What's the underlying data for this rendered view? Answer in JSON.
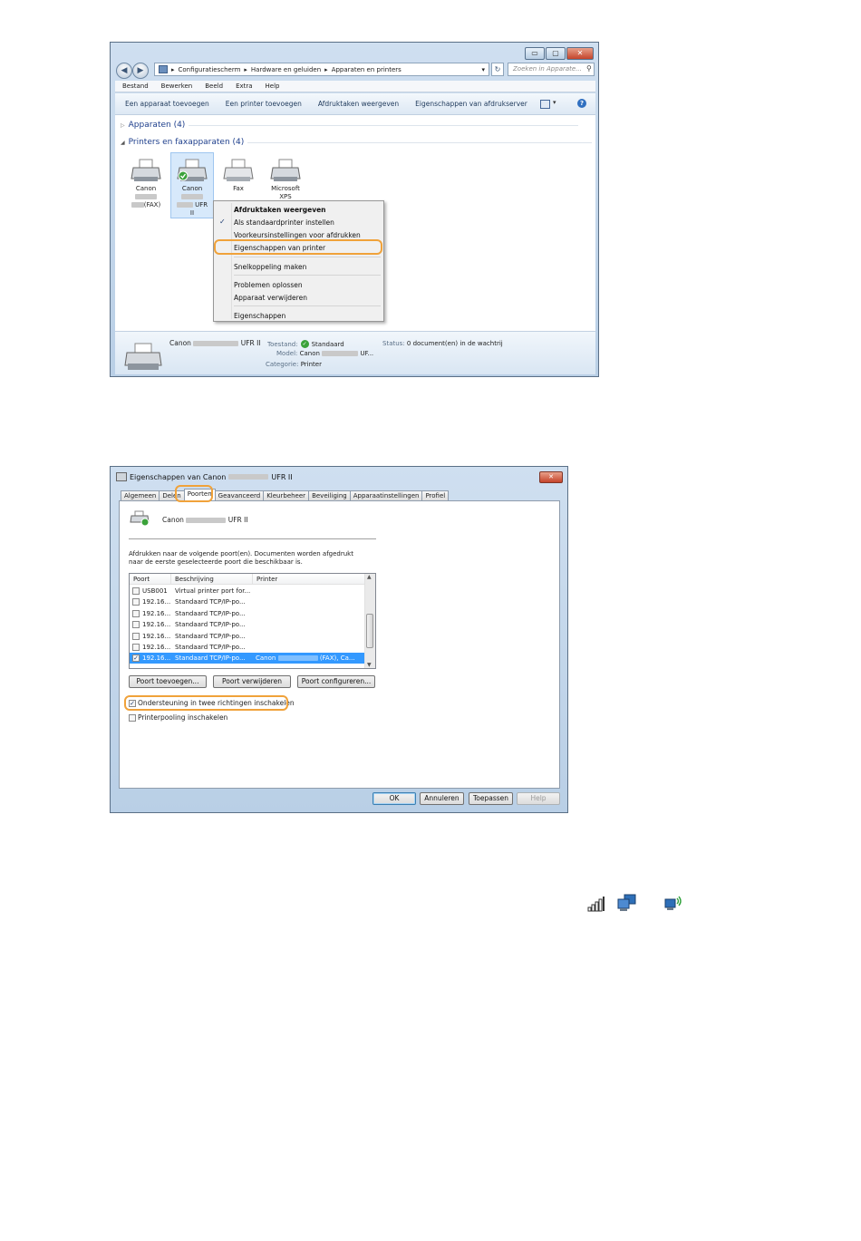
{
  "explorer": {
    "window_controls": {
      "minimize": "▭",
      "maximize": "▢",
      "close": "✕"
    },
    "breadcrumb": [
      "Configuratiescherm",
      "Hardware en geluiden",
      "Apparaten en printers"
    ],
    "search_placeholder": "Zoeken in Apparate...",
    "menu": [
      "Bestand",
      "Bewerken",
      "Beeld",
      "Extra",
      "Help"
    ],
    "commands": [
      "Een apparaat toevoegen",
      "Een printer toevoegen",
      "Afdruktaken weergeven",
      "Eigenschappen van afdrukserver",
      "»"
    ],
    "groups": {
      "devices": "Apparaten (4)",
      "printers": "Printers en faxapparaten (4)"
    },
    "devices": [
      {
        "line1": "Canon",
        "line3": "(FAX)"
      },
      {
        "line1": "Canon",
        "line3": "UFR",
        "line4": "II"
      },
      {
        "line1": "Fax"
      },
      {
        "line1": "Microsoft",
        "line2": "XPS"
      }
    ],
    "context_menu": {
      "view_jobs": "Afdruktaken weergeven",
      "set_default": "Als standaardprinter instellen",
      "preferences": "Voorkeursinstellingen voor afdrukken",
      "printer_props": "Eigenschappen van printer",
      "shortcut": "Snelkoppeling maken",
      "troubleshoot": "Problemen oplossen",
      "remove": "Apparaat verwijderen",
      "properties": "Eigenschappen"
    },
    "details": {
      "name_prefix": "Canon",
      "name_suffix": "UFR II",
      "state_label": "Toestand:",
      "state_value": "Standaard",
      "status_label": "Status:",
      "status_value": "0 document(en) in de wachtrij",
      "model_label": "Model:",
      "model_value_prefix": "Canon",
      "model_value_suffix": "UF...",
      "category_label": "Categorie:",
      "category_value": "Printer"
    }
  },
  "props": {
    "title_prefix": "Eigenschappen van Canon",
    "title_suffix": "UFR II",
    "close": "✕",
    "tabs": [
      "Algemeen",
      "Delen",
      "Poorten",
      "Geavanceerd",
      "Kleurbeheer",
      "Beveiliging",
      "Apparaatinstellingen",
      "Profiel"
    ],
    "printer_prefix": "Canon",
    "printer_suffix": "UFR II",
    "description": "Afdrukken naar de volgende poort(en). Documenten worden afgedrukt naar de eerste geselecteerde poort die beschikbaar is.",
    "columns": [
      "Poort",
      "Beschrijving",
      "Printer"
    ],
    "ports": [
      {
        "port": "USB001",
        "desc": "Virtual printer port for...",
        "printer": "",
        "checked": false,
        "selected": false
      },
      {
        "port": "192.16...",
        "desc": "Standaard TCP/IP-po...",
        "printer": "",
        "checked": false,
        "selected": false
      },
      {
        "port": "192.16...",
        "desc": "Standaard TCP/IP-po...",
        "printer": "",
        "checked": false,
        "selected": false
      },
      {
        "port": "192.16...",
        "desc": "Standaard TCP/IP-po...",
        "printer": "",
        "checked": false,
        "selected": false
      },
      {
        "port": "192.16...",
        "desc": "Standaard TCP/IP-po...",
        "printer": "",
        "checked": false,
        "selected": false
      },
      {
        "port": "192.16...",
        "desc": "Standaard TCP/IP-po...",
        "printer": "",
        "checked": false,
        "selected": false
      },
      {
        "port": "192.16...",
        "desc": "Standaard TCP/IP-po...",
        "printer": "Canon",
        "printer_tail": "(FAX), Ca...",
        "checked": true,
        "selected": true
      }
    ],
    "buttons": {
      "add": "Poort toevoegen...",
      "remove": "Poort verwijderen",
      "configure": "Poort configureren..."
    },
    "bidirectional": "Ondersteuning in twee richtingen inschakelen",
    "pooling": "Printerpooling inschakelen",
    "footer": {
      "ok": "OK",
      "cancel": "Annuleren",
      "apply": "Toepassen",
      "help": "Help"
    }
  },
  "colors": {
    "highlight": "#f0a23a",
    "selection": "#3399ff",
    "link": "#1e3f8c"
  }
}
